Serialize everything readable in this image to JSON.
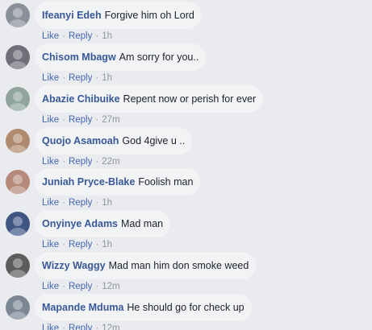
{
  "labels": {
    "like": "Like",
    "reply": "Reply",
    "separator": "·"
  },
  "comments": [
    {
      "author": "Ifeanyi Edeh",
      "text": "Forgive him oh Lord",
      "time": "1h",
      "avatar_color": "#8a9099"
    },
    {
      "author": "Chisom Mbagw",
      "text": "Am sorry for you..",
      "time": "1h",
      "avatar_color": "#6f6f7a"
    },
    {
      "author": "Abazie Chibuike",
      "text": "Repent now or perish for ever",
      "time": "27m",
      "avatar_color": "#8fa49a"
    },
    {
      "author": "Quojo Asamoah",
      "text": "God 4give u ..",
      "time": "22m",
      "avatar_color": "#b08a6e"
    },
    {
      "author": "Juniah Pryce-Blake",
      "text": "Foolish man",
      "time": "1h",
      "avatar_color": "#b58a7a"
    },
    {
      "author": "Onyinye Adams",
      "text": "Mad man",
      "time": "1h",
      "avatar_color": "#3f5685"
    },
    {
      "author": "Wizzy Waggy",
      "text": "Mad man him don smoke weed",
      "time": "12m",
      "avatar_color": "#5d5d5d"
    },
    {
      "author": "Mapande Mduma",
      "text": "He should go for check up",
      "time": "12m",
      "avatar_color": "#7c8794"
    }
  ]
}
